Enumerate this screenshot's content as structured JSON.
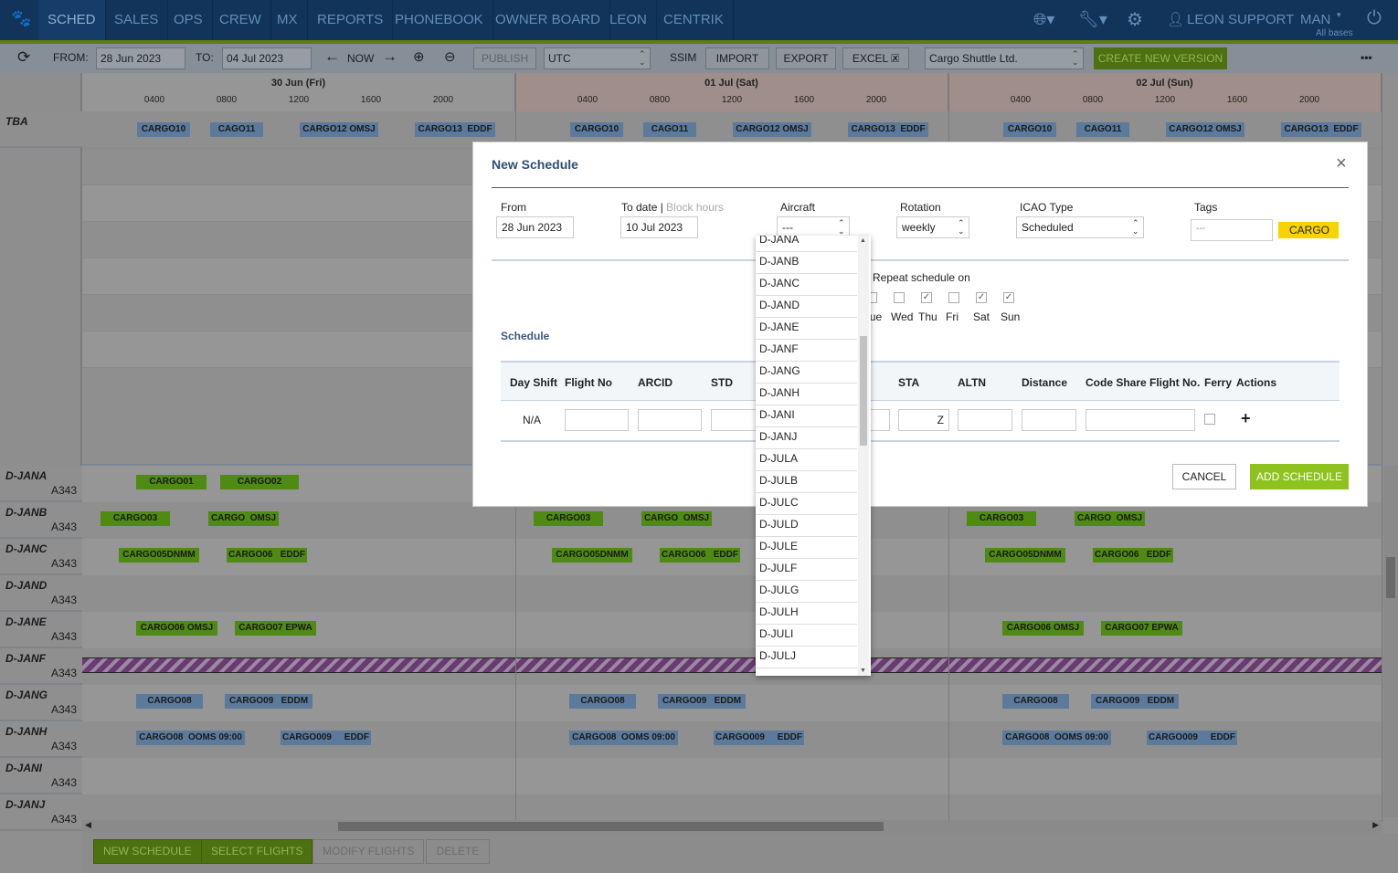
{
  "nav": {
    "items": [
      "SCHED",
      "SALES",
      "OPS",
      "CREW",
      "MX",
      "REPORTS",
      "PHONEBOOK",
      "OWNER BOARD",
      "LEON",
      "CENTRIK"
    ],
    "active": "SCHED",
    "user": "LEON SUPPORT",
    "base": "MAN",
    "base_sub": "All bases"
  },
  "toolbar": {
    "from_label": "FROM:",
    "from": "28 Jun 2023",
    "to_label": "TO:",
    "to": "04 Jul 2023",
    "now": "NOW",
    "publish": "PUBLISH",
    "timezone": "UTC",
    "ssim": "SSIM",
    "import": "IMPORT",
    "export": "EXPORT",
    "excel": "EXCEL",
    "operator": "Cargo Shuttle Ltd.",
    "create_version": "CREATE NEW VERSION",
    "more": "•••"
  },
  "timeline": {
    "days": [
      "30 Jun (Fri)",
      "01 Jul (Sat)",
      "02 Jul (Sun)"
    ],
    "ticks": [
      "0400",
      "0800",
      "1200",
      "1600",
      "2000"
    ]
  },
  "rows": [
    {
      "aircraft": "TBA",
      "type": "",
      "flights": [
        {
          "label": "CARGO10",
          "color": "blue"
        },
        {
          "label": "CAGO11",
          "color": "blue"
        },
        {
          "label": "CARGO12 OMSJ",
          "color": "blue"
        },
        {
          "label": "CARGO13  EDDF",
          "color": "blue"
        }
      ]
    },
    {
      "aircraft": "D-JANA",
      "type": "A343",
      "flights": [
        {
          "label": "CARGO01",
          "color": "green"
        },
        {
          "label": "CARGO02",
          "color": "green"
        }
      ]
    },
    {
      "aircraft": "D-JANB",
      "type": "A343",
      "flights": [
        {
          "label": "CARGO03",
          "color": "green"
        },
        {
          "label": "CARGO  OMSJ",
          "color": "green"
        }
      ]
    },
    {
      "aircraft": "D-JANC",
      "type": "A343",
      "flights": [
        {
          "label": "CARGO05DNMM",
          "color": "green"
        },
        {
          "label": "CARGO06   EDDF",
          "color": "green"
        }
      ]
    },
    {
      "aircraft": "D-JAND",
      "type": "A343",
      "flights": []
    },
    {
      "aircraft": "D-JANE",
      "type": "A343",
      "flights": [
        {
          "label": "CARGO06 OMSJ",
          "color": "green"
        },
        {
          "label": "CARGO07 EPWA",
          "color": "green"
        }
      ]
    },
    {
      "aircraft": "D-JANF",
      "type": "A343",
      "flights": [],
      "blocked": true
    },
    {
      "aircraft": "D-JANG",
      "type": "A343",
      "flights": [
        {
          "label": "CARGO08",
          "color": "blue"
        },
        {
          "label": "CARGO09   EDDM",
          "color": "blue"
        }
      ]
    },
    {
      "aircraft": "D-JANH",
      "type": "A343",
      "flights": [
        {
          "label": "CARGO08  OOMS 09:00",
          "color": "blue"
        },
        {
          "label": "CARGO009     EDDF",
          "color": "blue"
        }
      ]
    },
    {
      "aircraft": "D-JANI",
      "type": "A343",
      "flights": []
    },
    {
      "aircraft": "D-JANJ",
      "type": "A343",
      "flights": []
    }
  ],
  "modal": {
    "title": "New Schedule",
    "from_label": "From",
    "from": "28 Jun 2023",
    "to_label": "To date",
    "block_hours": "Block hours",
    "to": "10 Jul 2023",
    "aircraft_label": "Aircraft",
    "aircraft": "---",
    "rotation_label": "Rotation",
    "rotation": "weekly",
    "icao_label": "ICAO Type",
    "icao": "Scheduled",
    "tags_label": "Tags",
    "tags": "---",
    "tag_badge": "CARGO",
    "repeat_label": "Repeat schedule on",
    "weekdays": [
      {
        "d": "Tue",
        "checked": false
      },
      {
        "d": "Wed",
        "checked": false
      },
      {
        "d": "Thu",
        "checked": true
      },
      {
        "d": "Fri",
        "checked": false
      },
      {
        "d": "Sat",
        "checked": true
      },
      {
        "d": "Sun",
        "checked": true
      }
    ],
    "schedule_label": "Schedule",
    "columns": [
      "Day Shift",
      "Flight No",
      "ARCID",
      "STD",
      "STA",
      "ALTN",
      "Distance",
      "Code Share Flight No.",
      "Ferry",
      "Actions"
    ],
    "row": {
      "day_shift": "N/A",
      "std_suffix": "Z",
      "sta_suffix": "Z"
    },
    "cancel": "CANCEL",
    "add": "ADD SCHEDULE",
    "aircraft_options": [
      "D-JANA",
      "D-JANB",
      "D-JANC",
      "D-JAND",
      "D-JANE",
      "D-JANF",
      "D-JANG",
      "D-JANH",
      "D-JANI",
      "D-JANJ",
      "D-JULA",
      "D-JULB",
      "D-JULC",
      "D-JULD",
      "D-JULE",
      "D-JULF",
      "D-JULG",
      "D-JULH",
      "D-JULI",
      "D-JULJ"
    ]
  },
  "footer": {
    "new_schedule": "NEW SCHEDULE",
    "select_flights": "SELECT FLIGHTS",
    "modify_flights": "MODIFY FLIGHTS",
    "delete": "DELETE"
  }
}
